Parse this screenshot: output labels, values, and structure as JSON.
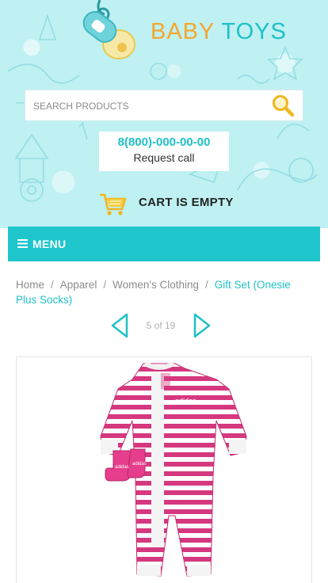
{
  "brand": {
    "word1": "BABY",
    "word2": "TOYS"
  },
  "search": {
    "placeholder": "SEARCH PRODUCTS",
    "button_icon": "search-icon"
  },
  "contact": {
    "phone": "8(800)-000-00-00",
    "request_label": "Request call"
  },
  "cart": {
    "icon": "cart-icon",
    "label": "CART IS EMPTY"
  },
  "menu": {
    "icon": "hamburger-icon",
    "label": "MENU"
  },
  "breadcrumb": {
    "items": [
      "Home",
      "Apparel",
      "Women's Clothing"
    ],
    "current": "Gift Set (Onesie Plus Socks)"
  },
  "pager": {
    "text": "5 of 19"
  },
  "product": {
    "image_alt": "striped pink onesie with socks"
  },
  "colors": {
    "accent": "#1ec6cc",
    "brand_orange": "#f4a72c",
    "header_bg": "#bff0f2"
  }
}
